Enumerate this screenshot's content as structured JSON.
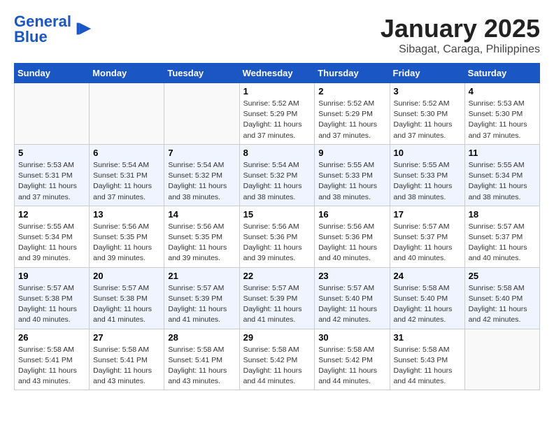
{
  "logo": {
    "text_general": "General",
    "text_blue": "Blue"
  },
  "title": "January 2025",
  "subtitle": "Sibagat, Caraga, Philippines",
  "weekdays": [
    "Sunday",
    "Monday",
    "Tuesday",
    "Wednesday",
    "Thursday",
    "Friday",
    "Saturday"
  ],
  "weeks": [
    [
      {
        "day": "",
        "sunrise": "",
        "sunset": "",
        "daylight": ""
      },
      {
        "day": "",
        "sunrise": "",
        "sunset": "",
        "daylight": ""
      },
      {
        "day": "",
        "sunrise": "",
        "sunset": "",
        "daylight": ""
      },
      {
        "day": "1",
        "sunrise": "Sunrise: 5:52 AM",
        "sunset": "Sunset: 5:29 PM",
        "daylight": "Daylight: 11 hours and 37 minutes."
      },
      {
        "day": "2",
        "sunrise": "Sunrise: 5:52 AM",
        "sunset": "Sunset: 5:29 PM",
        "daylight": "Daylight: 11 hours and 37 minutes."
      },
      {
        "day": "3",
        "sunrise": "Sunrise: 5:52 AM",
        "sunset": "Sunset: 5:30 PM",
        "daylight": "Daylight: 11 hours and 37 minutes."
      },
      {
        "day": "4",
        "sunrise": "Sunrise: 5:53 AM",
        "sunset": "Sunset: 5:30 PM",
        "daylight": "Daylight: 11 hours and 37 minutes."
      }
    ],
    [
      {
        "day": "5",
        "sunrise": "Sunrise: 5:53 AM",
        "sunset": "Sunset: 5:31 PM",
        "daylight": "Daylight: 11 hours and 37 minutes."
      },
      {
        "day": "6",
        "sunrise": "Sunrise: 5:54 AM",
        "sunset": "Sunset: 5:31 PM",
        "daylight": "Daylight: 11 hours and 37 minutes."
      },
      {
        "day": "7",
        "sunrise": "Sunrise: 5:54 AM",
        "sunset": "Sunset: 5:32 PM",
        "daylight": "Daylight: 11 hours and 38 minutes."
      },
      {
        "day": "8",
        "sunrise": "Sunrise: 5:54 AM",
        "sunset": "Sunset: 5:32 PM",
        "daylight": "Daylight: 11 hours and 38 minutes."
      },
      {
        "day": "9",
        "sunrise": "Sunrise: 5:55 AM",
        "sunset": "Sunset: 5:33 PM",
        "daylight": "Daylight: 11 hours and 38 minutes."
      },
      {
        "day": "10",
        "sunrise": "Sunrise: 5:55 AM",
        "sunset": "Sunset: 5:33 PM",
        "daylight": "Daylight: 11 hours and 38 minutes."
      },
      {
        "day": "11",
        "sunrise": "Sunrise: 5:55 AM",
        "sunset": "Sunset: 5:34 PM",
        "daylight": "Daylight: 11 hours and 38 minutes."
      }
    ],
    [
      {
        "day": "12",
        "sunrise": "Sunrise: 5:55 AM",
        "sunset": "Sunset: 5:34 PM",
        "daylight": "Daylight: 11 hours and 39 minutes."
      },
      {
        "day": "13",
        "sunrise": "Sunrise: 5:56 AM",
        "sunset": "Sunset: 5:35 PM",
        "daylight": "Daylight: 11 hours and 39 minutes."
      },
      {
        "day": "14",
        "sunrise": "Sunrise: 5:56 AM",
        "sunset": "Sunset: 5:35 PM",
        "daylight": "Daylight: 11 hours and 39 minutes."
      },
      {
        "day": "15",
        "sunrise": "Sunrise: 5:56 AM",
        "sunset": "Sunset: 5:36 PM",
        "daylight": "Daylight: 11 hours and 39 minutes."
      },
      {
        "day": "16",
        "sunrise": "Sunrise: 5:56 AM",
        "sunset": "Sunset: 5:36 PM",
        "daylight": "Daylight: 11 hours and 40 minutes."
      },
      {
        "day": "17",
        "sunrise": "Sunrise: 5:57 AM",
        "sunset": "Sunset: 5:37 PM",
        "daylight": "Daylight: 11 hours and 40 minutes."
      },
      {
        "day": "18",
        "sunrise": "Sunrise: 5:57 AM",
        "sunset": "Sunset: 5:37 PM",
        "daylight": "Daylight: 11 hours and 40 minutes."
      }
    ],
    [
      {
        "day": "19",
        "sunrise": "Sunrise: 5:57 AM",
        "sunset": "Sunset: 5:38 PM",
        "daylight": "Daylight: 11 hours and 40 minutes."
      },
      {
        "day": "20",
        "sunrise": "Sunrise: 5:57 AM",
        "sunset": "Sunset: 5:38 PM",
        "daylight": "Daylight: 11 hours and 41 minutes."
      },
      {
        "day": "21",
        "sunrise": "Sunrise: 5:57 AM",
        "sunset": "Sunset: 5:39 PM",
        "daylight": "Daylight: 11 hours and 41 minutes."
      },
      {
        "day": "22",
        "sunrise": "Sunrise: 5:57 AM",
        "sunset": "Sunset: 5:39 PM",
        "daylight": "Daylight: 11 hours and 41 minutes."
      },
      {
        "day": "23",
        "sunrise": "Sunrise: 5:57 AM",
        "sunset": "Sunset: 5:40 PM",
        "daylight": "Daylight: 11 hours and 42 minutes."
      },
      {
        "day": "24",
        "sunrise": "Sunrise: 5:58 AM",
        "sunset": "Sunset: 5:40 PM",
        "daylight": "Daylight: 11 hours and 42 minutes."
      },
      {
        "day": "25",
        "sunrise": "Sunrise: 5:58 AM",
        "sunset": "Sunset: 5:40 PM",
        "daylight": "Daylight: 11 hours and 42 minutes."
      }
    ],
    [
      {
        "day": "26",
        "sunrise": "Sunrise: 5:58 AM",
        "sunset": "Sunset: 5:41 PM",
        "daylight": "Daylight: 11 hours and 43 minutes."
      },
      {
        "day": "27",
        "sunrise": "Sunrise: 5:58 AM",
        "sunset": "Sunset: 5:41 PM",
        "daylight": "Daylight: 11 hours and 43 minutes."
      },
      {
        "day": "28",
        "sunrise": "Sunrise: 5:58 AM",
        "sunset": "Sunset: 5:41 PM",
        "daylight": "Daylight: 11 hours and 43 minutes."
      },
      {
        "day": "29",
        "sunrise": "Sunrise: 5:58 AM",
        "sunset": "Sunset: 5:42 PM",
        "daylight": "Daylight: 11 hours and 44 minutes."
      },
      {
        "day": "30",
        "sunrise": "Sunrise: 5:58 AM",
        "sunset": "Sunset: 5:42 PM",
        "daylight": "Daylight: 11 hours and 44 minutes."
      },
      {
        "day": "31",
        "sunrise": "Sunrise: 5:58 AM",
        "sunset": "Sunset: 5:43 PM",
        "daylight": "Daylight: 11 hours and 44 minutes."
      },
      {
        "day": "",
        "sunrise": "",
        "sunset": "",
        "daylight": ""
      }
    ]
  ]
}
